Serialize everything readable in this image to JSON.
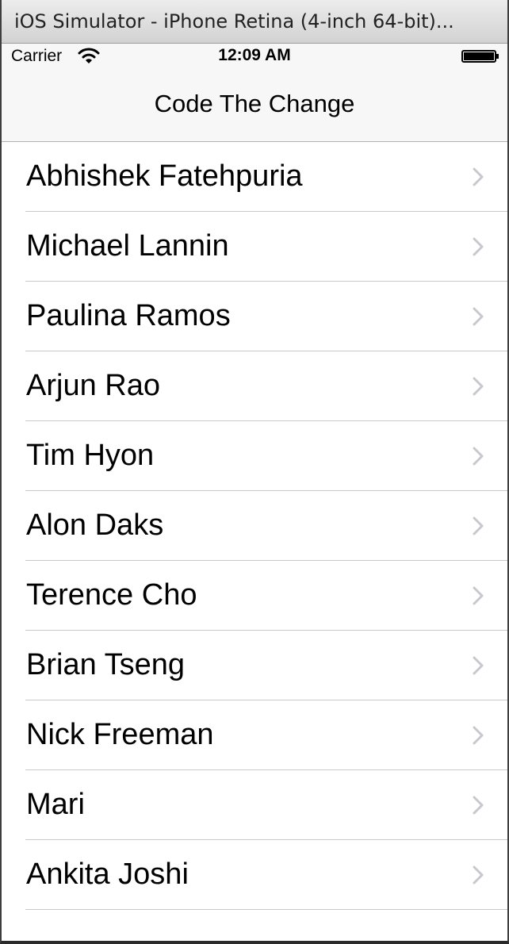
{
  "window": {
    "title": "iOS Simulator - iPhone Retina (4-inch 64-bit)..."
  },
  "status_bar": {
    "carrier": "Carrier",
    "time": "12:09 AM",
    "icons": [
      "wifi-icon",
      "battery-icon"
    ]
  },
  "nav_bar": {
    "title": "Code The Change"
  },
  "list": {
    "items": [
      {
        "label": "Abhishek Fatehpuria"
      },
      {
        "label": "Michael Lannin"
      },
      {
        "label": "Paulina Ramos"
      },
      {
        "label": "Arjun Rao"
      },
      {
        "label": "Tim Hyon"
      },
      {
        "label": "Alon Daks"
      },
      {
        "label": "Terence Cho"
      },
      {
        "label": "Brian Tseng"
      },
      {
        "label": "Nick Freeman"
      },
      {
        "label": "Mari"
      },
      {
        "label": "Ankita Joshi"
      }
    ],
    "accessory_icon": "chevron-right-icon"
  }
}
